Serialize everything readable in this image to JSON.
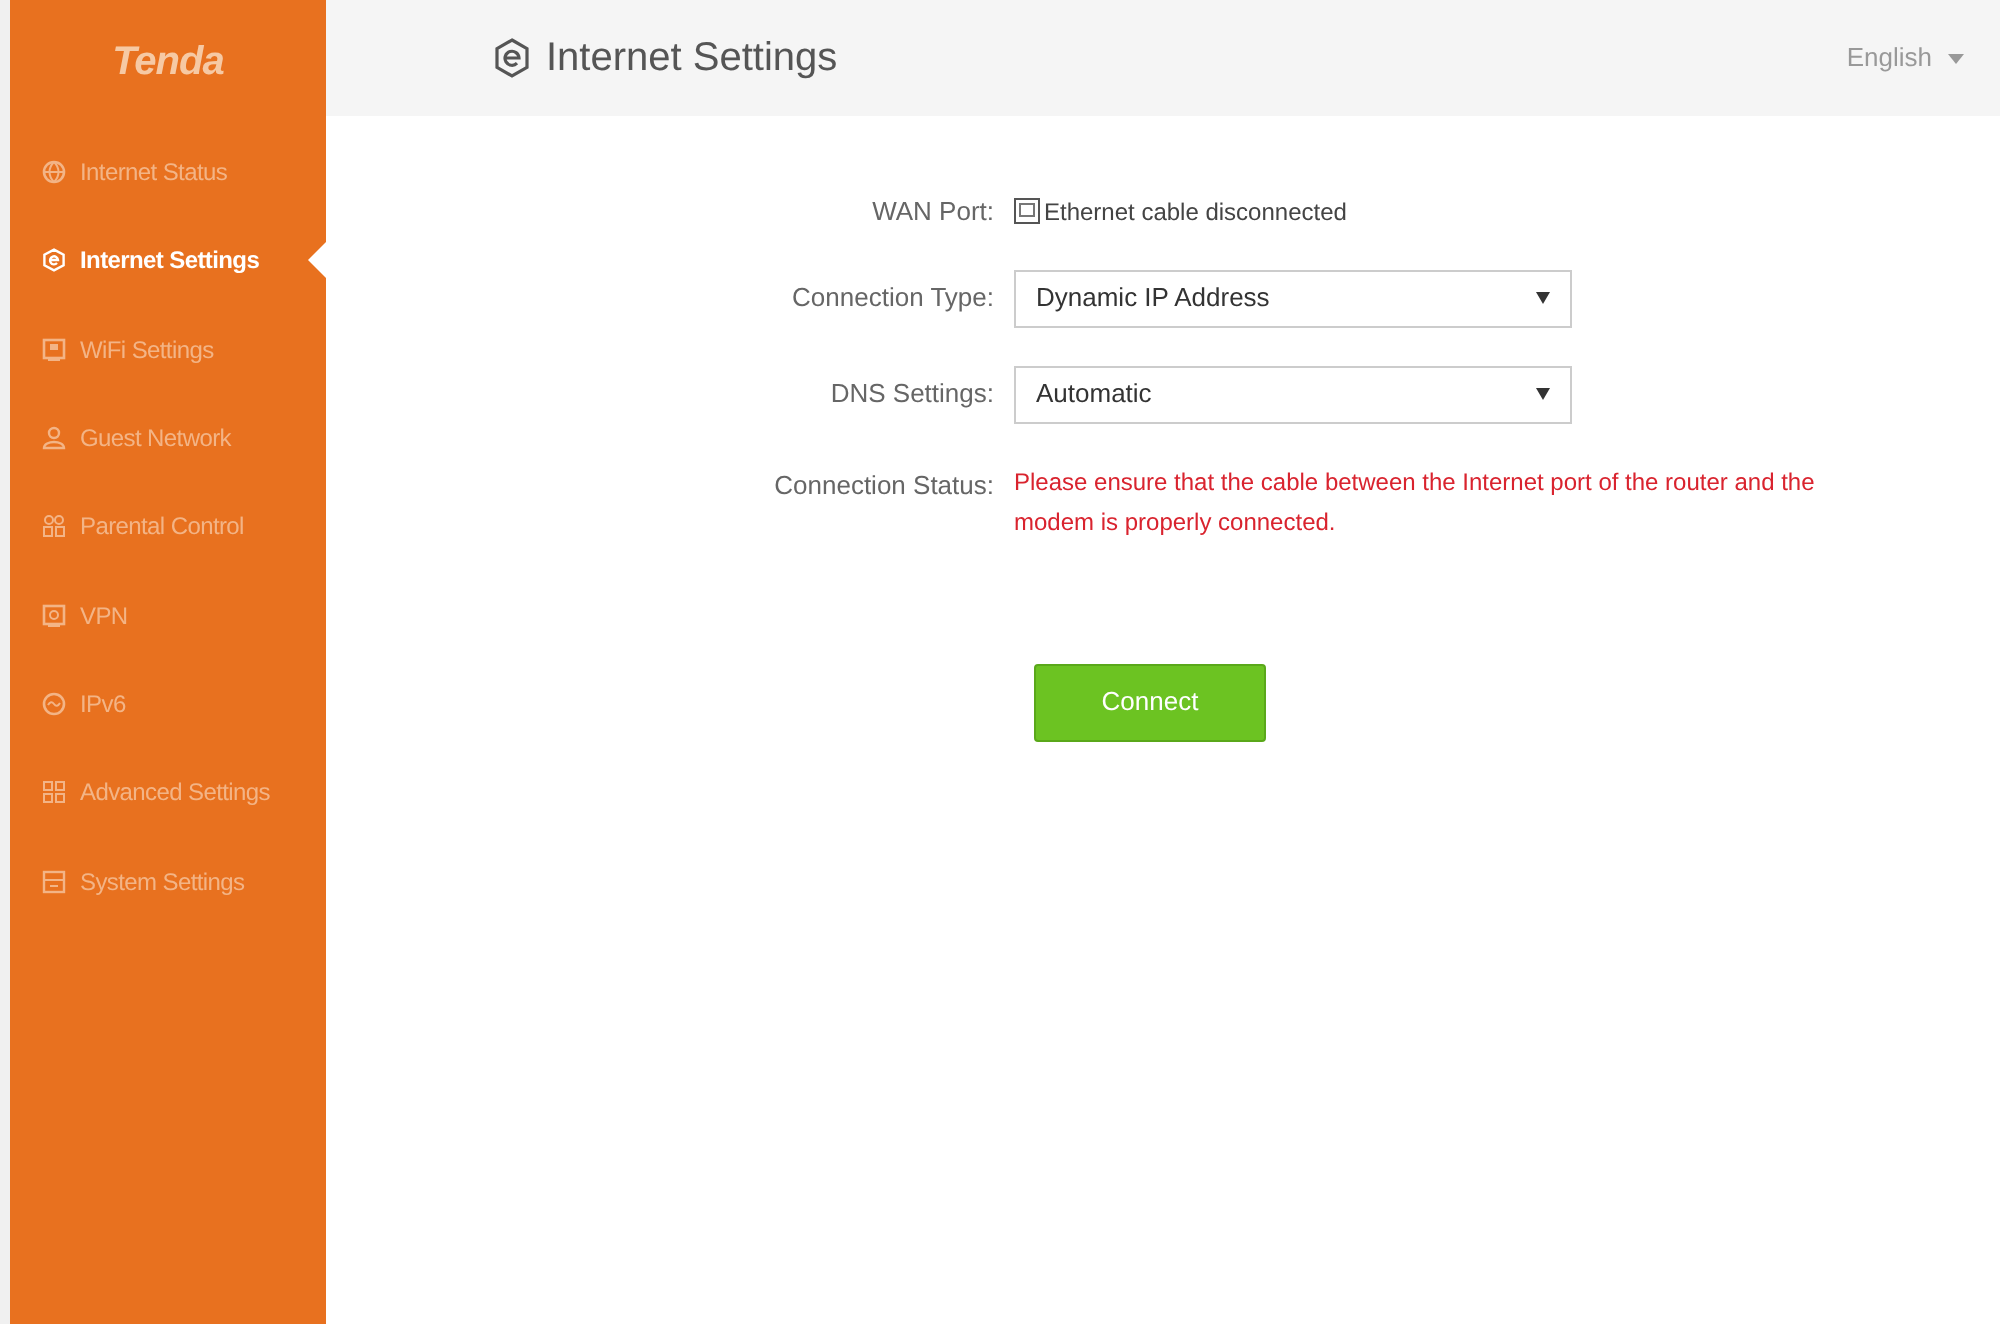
{
  "sidebar": {
    "logo": "Tenda",
    "items": [
      {
        "label": "Internet Status",
        "selected": false
      },
      {
        "label": "Internet Settings",
        "selected": true
      },
      {
        "label": "WiFi Settings",
        "selected": false
      },
      {
        "label": "Guest Network",
        "selected": false
      },
      {
        "label": "Parental Control",
        "selected": false
      },
      {
        "label": "VPN",
        "selected": false
      },
      {
        "label": "IPv6",
        "selected": false
      },
      {
        "label": "Advanced Settings",
        "selected": false
      },
      {
        "label": "System Settings",
        "selected": false
      }
    ]
  },
  "header": {
    "title": "Internet Settings",
    "language": "English"
  },
  "form": {
    "rows": [
      {
        "kind": "status",
        "label": "WAN Port:",
        "value": "Ethernet cable disconnected"
      },
      {
        "kind": "select",
        "label": "Connection Type:",
        "value": "Dynamic IP Address"
      },
      {
        "kind": "select",
        "label": "DNS Settings:",
        "value": "Automatic"
      },
      {
        "kind": "message",
        "label": "Connection Status:",
        "value": "Please ensure that the cable between the Internet port of the router and the modem is properly connected."
      }
    ],
    "button": "Connect"
  }
}
